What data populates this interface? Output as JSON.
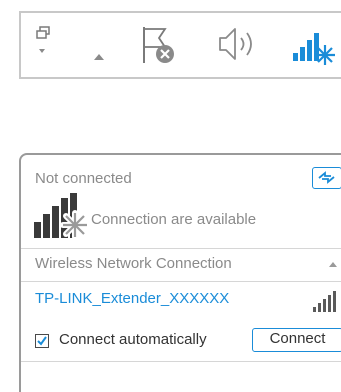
{
  "taskbar": {
    "icons": [
      "action-center-icon",
      "chevron-up-icon",
      "flag-error-icon",
      "speaker-icon",
      "wifi-available-icon"
    ]
  },
  "panel": {
    "status": "Not connected",
    "refresh_icon": "refresh-icon",
    "availability": "Connection are available",
    "section_title": "Wireless Network Connection",
    "network": {
      "ssid": "TP-LINK_Extender_XXXXXX",
      "signal_icon": "signal-strength-icon"
    },
    "auto_connect": {
      "label": "Connect automatically",
      "checked": true
    },
    "connect_button": "Connect"
  },
  "colors": {
    "accent": "#1a8cd8",
    "muted_text": "#8a8a8a",
    "border": "#c8c8c8"
  }
}
